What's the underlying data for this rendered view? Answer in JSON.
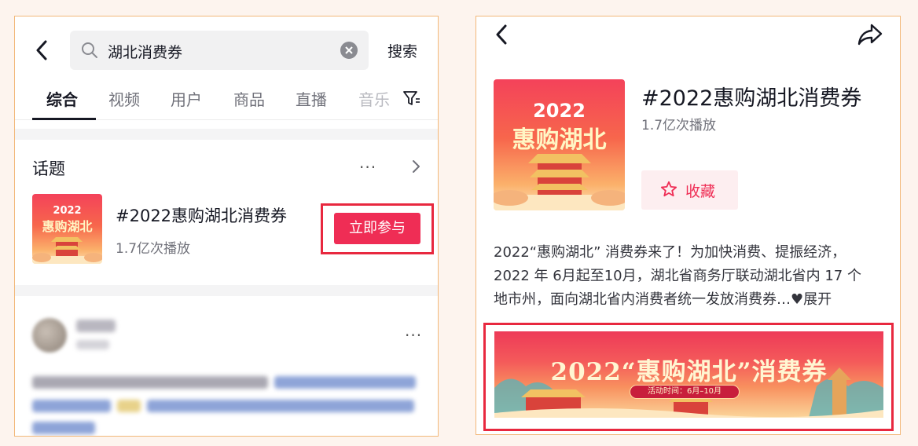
{
  "colors": {
    "accent": "#ef2d55",
    "highlight_box": "#e8283f",
    "panel_border": "#f2b879"
  },
  "search": {
    "query": "湖北消费券",
    "button_label": "搜索"
  },
  "tabs": [
    {
      "label": "综合",
      "active": true
    },
    {
      "label": "视频",
      "active": false
    },
    {
      "label": "用户",
      "active": false
    },
    {
      "label": "商品",
      "active": false
    },
    {
      "label": "直播",
      "active": false
    },
    {
      "label": "音乐",
      "active": false
    }
  ],
  "topic_section": {
    "title": "话题",
    "more": "···",
    "topic": {
      "name": "#2022惠购湖北消费券",
      "plays": "1.7亿次播放",
      "join_label": "立即参与",
      "thumb_year": "2022",
      "thumb_title": "惠购湖北"
    }
  },
  "post_preview": {
    "more": "···"
  },
  "detail": {
    "title": "#2022惠购湖北消费券",
    "plays": "1.7亿次播放",
    "favorite_label": "收藏",
    "thumb_year": "2022",
    "thumb_title": "惠购湖北",
    "description_lines": [
      "2022“惠购湖北” 消费券来了！为加快消费、提振经济，",
      "2022 年 6月起至10月，湖北省商务厅联动湖北省内 17 个",
      "地市州，面向湖北省内消费者统一发放消费券…♥展开"
    ],
    "banner_title": "2022“惠购湖北”消费券",
    "banner_subtitle": "活动时间：6月–10月"
  },
  "icons": {
    "back": "chevron-left-icon",
    "search": "search-icon",
    "clear": "clear-icon",
    "filter": "filter-icon",
    "more": "more-icon",
    "arrow": "chevron-right-icon",
    "share": "share-icon",
    "favorite": "star-icon"
  }
}
